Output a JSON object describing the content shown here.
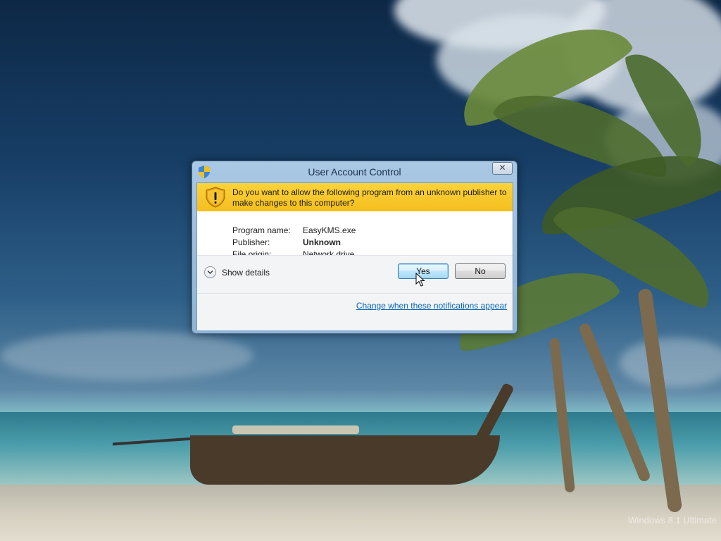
{
  "dialog": {
    "title": "User Account Control",
    "close_glyph": "✕",
    "question": "Do you want to allow the following program from an unknown publisher to make changes to this computer?",
    "fields": [
      {
        "label": "Program name:",
        "value": "EasyKMS.exe"
      },
      {
        "label": "Publisher:",
        "value": "Unknown"
      },
      {
        "label": "File origin:",
        "value": "Network drive"
      }
    ],
    "show_details": "Show details",
    "yes_label": "Yes",
    "no_label": "No",
    "change_link": "Change when these notifications appear",
    "icons": {
      "title": "shield-icon",
      "banner": "warning-shield-icon",
      "expand": "chevron-down-icon"
    }
  },
  "desktop": {
    "watermark": "Windows 8.1 Ultimate"
  },
  "colors": {
    "banner": "#f4be1e",
    "link": "#0b66b6",
    "yes_button_border": "#3c7fb1"
  }
}
